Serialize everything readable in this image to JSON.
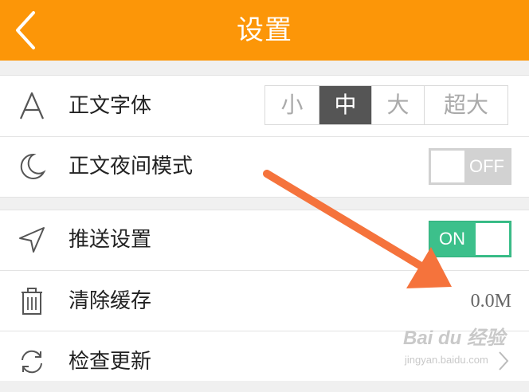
{
  "header": {
    "title": "设置",
    "back_icon": "chevron-left-icon"
  },
  "settings": {
    "font": {
      "label": "正文字体",
      "icon": "letter-a-icon",
      "options": [
        "小",
        "中",
        "大",
        "超大"
      ],
      "selected": "中"
    },
    "night_mode": {
      "label": "正文夜间模式",
      "icon": "moon-icon",
      "state_label": "OFF",
      "enabled": false
    },
    "push": {
      "label": "推送设置",
      "icon": "navigation-arrow-icon",
      "state_label": "ON",
      "enabled": true
    },
    "clear_cache": {
      "label": "清除缓存",
      "icon": "trash-icon",
      "value": "0.0M"
    },
    "check_update": {
      "label": "检查更新",
      "icon": "refresh-icon"
    }
  },
  "watermark": {
    "logo": "Bai du 经验",
    "url": "jingyan.baidu.com"
  },
  "colors": {
    "header": "#fc9608",
    "toggle_on": "#3cc08b",
    "toggle_off": "#d2d2d2",
    "selected_segment": "#555555",
    "arrow": "#f5733c"
  }
}
